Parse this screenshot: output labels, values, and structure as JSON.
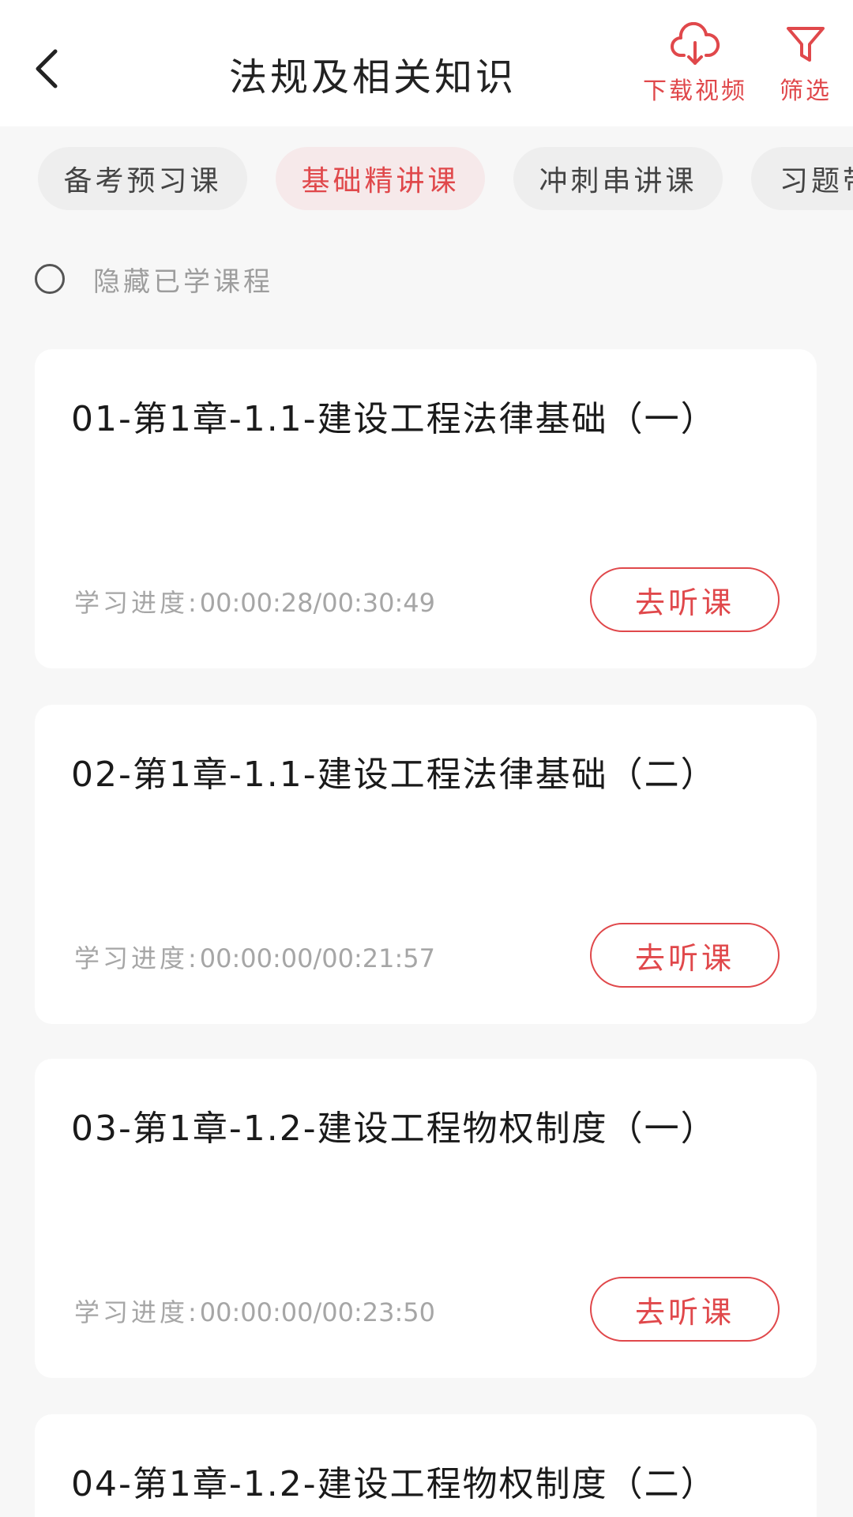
{
  "header": {
    "title": "法规及相关知识",
    "download_label": "下载视频",
    "filter_label": "筛选",
    "accent_color": "#e0484b"
  },
  "tabs": [
    {
      "label": "备考预习课",
      "active": false
    },
    {
      "label": "基础精讲课",
      "active": true
    },
    {
      "label": "冲刺串讲课",
      "active": false
    },
    {
      "label": "习题带",
      "active": false
    }
  ],
  "filter": {
    "hide_learned_label": "隐藏已学课程",
    "hide_learned_checked": false
  },
  "courses": [
    {
      "title": "01-第1章-1.1-建设工程法律基础（一）",
      "progress_prefix": "学习进度:",
      "progress": "00:00:28/00:30:49",
      "button": "去听课"
    },
    {
      "title": "02-第1章-1.1-建设工程法律基础（二）",
      "progress_prefix": "学习进度:",
      "progress": "00:00:00/00:21:57",
      "button": "去听课"
    },
    {
      "title": "03-第1章-1.2-建设工程物权制度（一）",
      "progress_prefix": "学习进度:",
      "progress": "00:00:00/00:23:50",
      "button": "去听课"
    },
    {
      "title": "04-第1章-1.2-建设工程物权制度（二）",
      "progress_prefix": "",
      "progress": "",
      "button": ""
    }
  ]
}
